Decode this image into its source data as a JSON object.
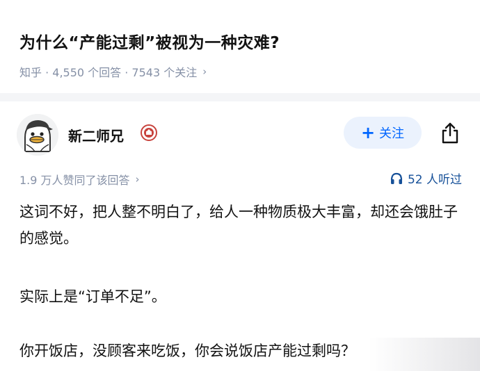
{
  "question": {
    "title": "为什么“产能过剩”被视为一种灾难?",
    "meta": "知乎 · 4,550 个回答 · 7543 个关注"
  },
  "answer": {
    "author_name": "新二师兄",
    "follow_label": "关注",
    "likes_text": "1.9 万人赞同了该回答",
    "listen_text": "52 人听过",
    "paragraphs": [
      "这词不好，把人整不明白了，给人一种物质极大丰富，却还会饿肚子的感觉。",
      "实际上是“订单不足”。",
      "你开饭店，没顾客来吃饭，你会说饭店产能过剩吗？"
    ]
  },
  "icons": {
    "avatar": "duck-avatar",
    "badge": "badge-icon",
    "share": "share-icon",
    "headphones": "headphones-icon",
    "chevron": "chevron-right-icon"
  },
  "colors": {
    "accent": "#0066ff",
    "muted": "#8590a6",
    "listen": "#175199",
    "follow_bg": "#ebf2fd"
  }
}
